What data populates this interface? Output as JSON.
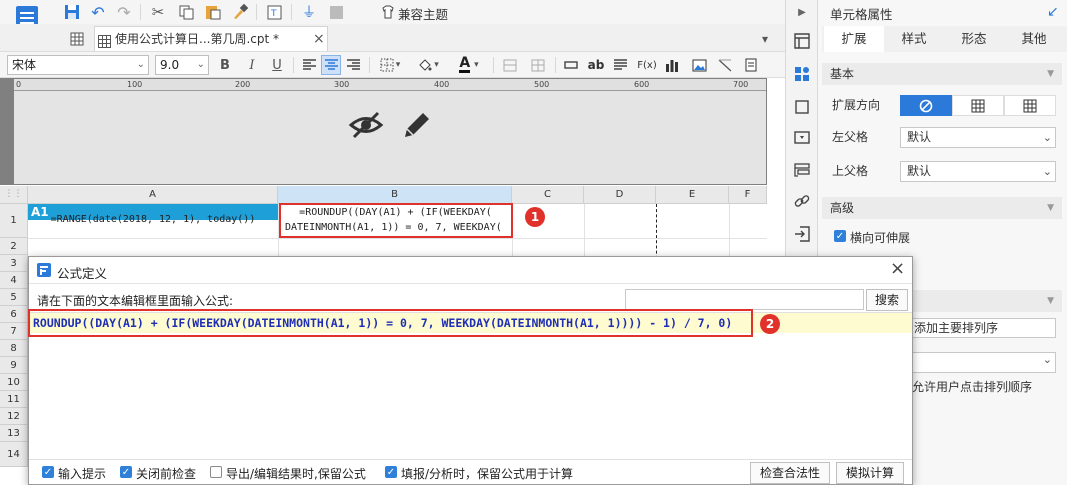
{
  "toolbar": {
    "theme_label": "兼容主题"
  },
  "file_tab": {
    "label": "使用公式计算日...第几周.cpt *",
    "close": "×"
  },
  "format_bar": {
    "font_name": "宋体",
    "font_size": "9.0",
    "bold": "B",
    "italic": "I",
    "underline": "U",
    "text_tool": "ab",
    "formula_tool": "F(x)"
  },
  "ruler": {
    "ticks": [
      "0",
      "100",
      "200",
      "300",
      "400",
      "500",
      "600",
      "700"
    ]
  },
  "grid": {
    "columns": [
      "A",
      "B",
      "C",
      "D",
      "E",
      "F"
    ],
    "rows": [
      "1",
      "2",
      "3",
      "4",
      "5",
      "6",
      "7",
      "8",
      "9",
      "10",
      "11",
      "12",
      "13",
      "14"
    ],
    "cell_ref": "A1",
    "cell_a1": "=RANGE(date(2018, 12, 1), today())",
    "cell_b1_line1": "=ROUNDUP((DAY(A1) + (IF(WEEKDAY(",
    "cell_b1_line2": "DATEINMONTH(A1, 1)) = 0, 7, WEEKDAY("
  },
  "annotations": {
    "badge1": "1",
    "badge2": "2"
  },
  "dialog": {
    "title": "公式定义",
    "close": "×",
    "prompt": "请在下面的文本编辑框里面输入公式:",
    "search_button": "搜索",
    "search_placeholder": "",
    "formula": "ROUNDUP((DAY(A1) + (IF(WEEKDAY(DATEINMONTH(A1, 1)) = 0, 7, WEEKDAY(DATEINMONTH(A1, 1)))) - 1) / 7, 0)",
    "options": [
      {
        "label": "输入提示",
        "checked": true
      },
      {
        "label": "关闭前检查",
        "checked": true
      },
      {
        "label": "导出/编辑结果时,保留公式",
        "checked": false
      },
      {
        "label": "填报/分析时，保留公式用于计算",
        "checked": true
      }
    ],
    "check_button": "检查合法性",
    "simulate_button": "模拟计算"
  },
  "properties": {
    "title": "单元格属性",
    "tabs": [
      "扩展",
      "样式",
      "形态",
      "其他"
    ],
    "active_tab": "扩展",
    "section_basic": "基本",
    "expand_direction_label": "扩展方向",
    "left_parent_label": "左父格",
    "left_parent_value": "默认",
    "top_parent_label": "上父格",
    "top_parent_value": "默认",
    "section_advanced": "高级",
    "horizontal_expand_label": "横向可伸展",
    "horizontal_expand_checked": true,
    "add_sort_text": "添加主要排列序",
    "allow_user_sort_text": "允许用户点击排列顺序"
  },
  "colors": {
    "accent": "#2b79d9",
    "highlight": "#e0322b",
    "selected_cell": "#1e9fd8",
    "formula_bg": "#fffbd0"
  }
}
